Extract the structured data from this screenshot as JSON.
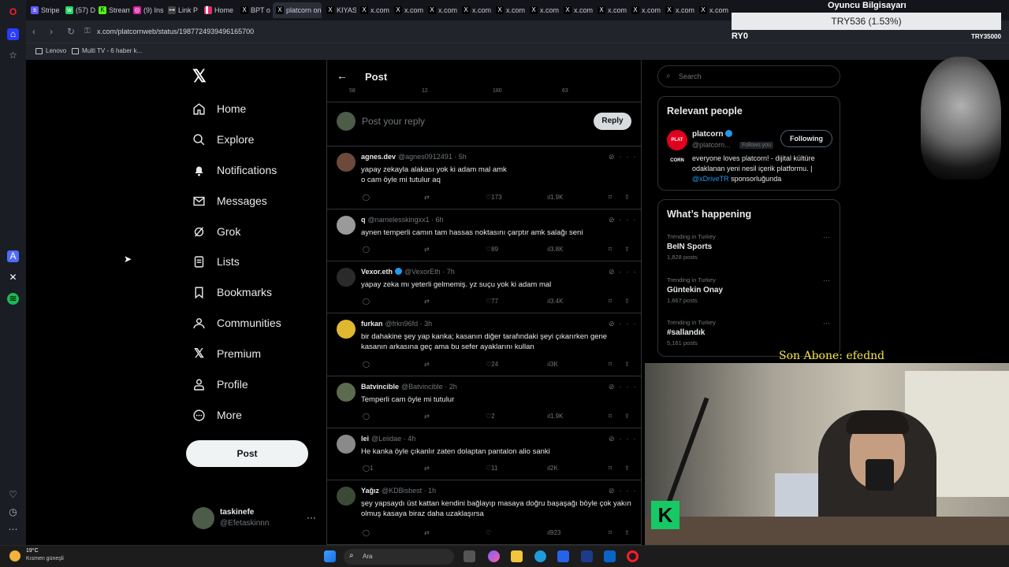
{
  "browser": {
    "tabs": [
      "Stripe",
      "(57) D",
      "Stream",
      "(9) Ins",
      "Link P",
      "Home",
      "BPT o",
      "platcorn on",
      "KIYAS",
      "x.com",
      "x.com",
      "x.com",
      "x.com",
      "x.com",
      "x.com",
      "x.com",
      "x.com",
      "x.com",
      "x.com",
      "x.com"
    ],
    "url": "x.com/platcornweb/status/1987724939496165700",
    "bookmarks": [
      "Lenovo",
      "Multi TV - 6 haber k..."
    ]
  },
  "stream_overlay": {
    "title": "Oyuncu Bilgisayarı",
    "ticker": "TRY536 (1.53%)",
    "left_code": "RY0",
    "right_code": "TRY35000",
    "subscriber": "Son Abone: efednd"
  },
  "x_nav": {
    "items": [
      "Home",
      "Explore",
      "Notifications",
      "Messages",
      "Grok",
      "Lists",
      "Bookmarks",
      "Communities",
      "Premium",
      "Profile",
      "More"
    ],
    "post_button": "Post",
    "account_name": "taskinefe",
    "account_handle": "@Efetaskinnn"
  },
  "center": {
    "title": "Post",
    "prev_counts": [
      "58",
      "12",
      "180",
      "63"
    ],
    "reply_placeholder": "Post your reply",
    "reply_button": "Reply",
    "tweets": [
      {
        "name": "agnes.dev",
        "handle": "@agnes0912491",
        "time": "5h",
        "text": "yapay zekayla alakası yok ki adam mal amk\no cam öyle mi tutulur aq",
        "replies": "",
        "retweets": "",
        "likes": "173",
        "views": "1.9K",
        "verified": false,
        "avatar_color": "#6b4a3c"
      },
      {
        "name": "q",
        "handle": "@namelesskingxx1",
        "time": "6h",
        "text": "aynen temperli camın tam hassas noktasını çarptır amk salağı seni",
        "replies": "",
        "retweets": "",
        "likes": "89",
        "views": "3.8K",
        "verified": false,
        "avatar_color": "#9a9a9a"
      },
      {
        "name": "Vexor.eth",
        "handle": "@VexorEth",
        "time": "7h",
        "text": "yapay zeka mı yeterli gelmemiş. yz suçu yok ki adam mal",
        "replies": "",
        "retweets": "",
        "likes": "77",
        "views": "3.4K",
        "verified": true,
        "avatar_color": "#2a2a2a"
      },
      {
        "name": "furkan",
        "handle": "@frkn96fd",
        "time": "3h",
        "text": "bir dahakine şey yap kanka; kasanın diğer tarafındaki şeyi çıkarırken gene kasanın arkasına geç ama bu sefer ayaklarını kullan",
        "replies": "",
        "retweets": "",
        "likes": "24",
        "views": "3K",
        "verified": false,
        "avatar_color": "#e0b82f"
      },
      {
        "name": "Batvincible",
        "handle": "@Batvincible",
        "time": "2h",
        "text": "Temperli cam öyle mi tutulur",
        "replies": "",
        "retweets": "",
        "likes": "2",
        "views": "1.9K",
        "verified": false,
        "avatar_color": "#5c6b4e"
      },
      {
        "name": "lei",
        "handle": "@Leiidae",
        "time": "4h",
        "text": "He kanka öyle çıkanlır zaten dolaptan pantalon alio sanki",
        "replies": "1",
        "retweets": "",
        "likes": "11",
        "views": "2K",
        "verified": false,
        "avatar_color": "#8a8a8a"
      },
      {
        "name": "Yağız",
        "handle": "@KDBisbest",
        "time": "1h",
        "text": "şey yapsaydı üst kattan kendini bağlayıp masaya doğru başaşağı böyle çok yakın olmuş kasaya biraz daha uzaklaşırsa",
        "replies": "",
        "retweets": "",
        "likes": "",
        "views": "923",
        "verified": false,
        "avatar_color": "#3a4a36"
      }
    ]
  },
  "right": {
    "search_placeholder": "Search",
    "relevant_title": "Relevant people",
    "person": {
      "name": "platcorn",
      "handle": "@platcorn...",
      "follows_you": "Follows you",
      "button": "Following",
      "avatar_text": "PLAT CORN",
      "bio": "everyone loves platcorn! - dijital kültüre odaklanan yeni nesil içerik platformu. |",
      "bio_link": "@xDriveTR",
      "bio_tail": "sponsorluğunda"
    },
    "happening_title": "What’s happening",
    "trends": [
      {
        "context": "Trending in Turkey",
        "title": "BeIN Sports",
        "posts": "1,828 posts"
      },
      {
        "context": "Trending in Turkey",
        "title": "Güntekin Onay",
        "posts": "1,667 posts"
      },
      {
        "context": "Trending in Turkey",
        "title": "#sallandık",
        "posts": "5,161 posts"
      }
    ]
  },
  "taskbar": {
    "temperature": "19°C",
    "weather": "Kısmen güneşli",
    "search_placeholder": "Ara"
  },
  "colors": {
    "accent": "#1d9bf0",
    "background": "#000000",
    "border": "#2f3336",
    "muted": "#71767b",
    "overlay_yellow": "#f5e34b"
  }
}
